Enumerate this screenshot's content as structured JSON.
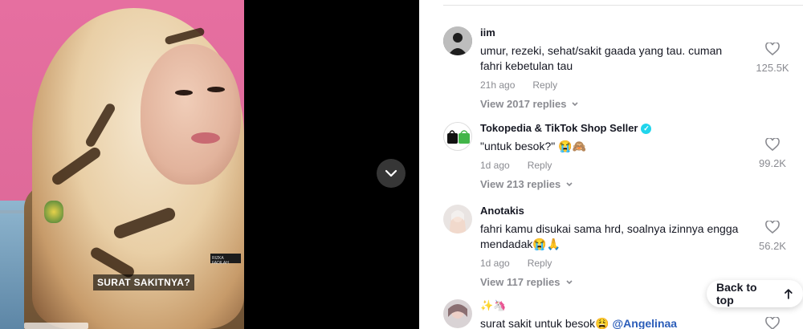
{
  "video": {
    "caption": "SURAT SAKITNYA?",
    "nametag": "RIZKA FADILAH"
  },
  "comments": [
    {
      "user": "iim",
      "text": "umur, rezeki, sehat/sakit gaada yang tau. cuman fahri kebetulan tau",
      "time": "21h ago",
      "reply_label": "Reply",
      "view_replies": "View 2017 replies",
      "likes": "125.5K"
    },
    {
      "user": "Tokopedia & TikTok Shop Seller",
      "verified": true,
      "text": "\"untuk besok?\" 😭🙈",
      "time": "1d ago",
      "reply_label": "Reply",
      "view_replies": "View 213 replies",
      "likes": "99.2K"
    },
    {
      "user": "Anotakis",
      "text": "fahri kamu disukai sama hrd, soalnya izinnya engga mendadak😭🙏",
      "time": "1d ago",
      "reply_label": "Reply",
      "view_replies": "View 117 replies",
      "likes": "56.2K"
    },
    {
      "user": "✨🦄",
      "text": "surat sakit untuk besok😩 ",
      "mention": "@Angelinaa"
    }
  ],
  "back_to_top": "Back to top",
  "colors": {
    "muted": "#8a8b91",
    "text": "#161823",
    "mention": "#2b5db9",
    "verified": "#20d5ec"
  }
}
